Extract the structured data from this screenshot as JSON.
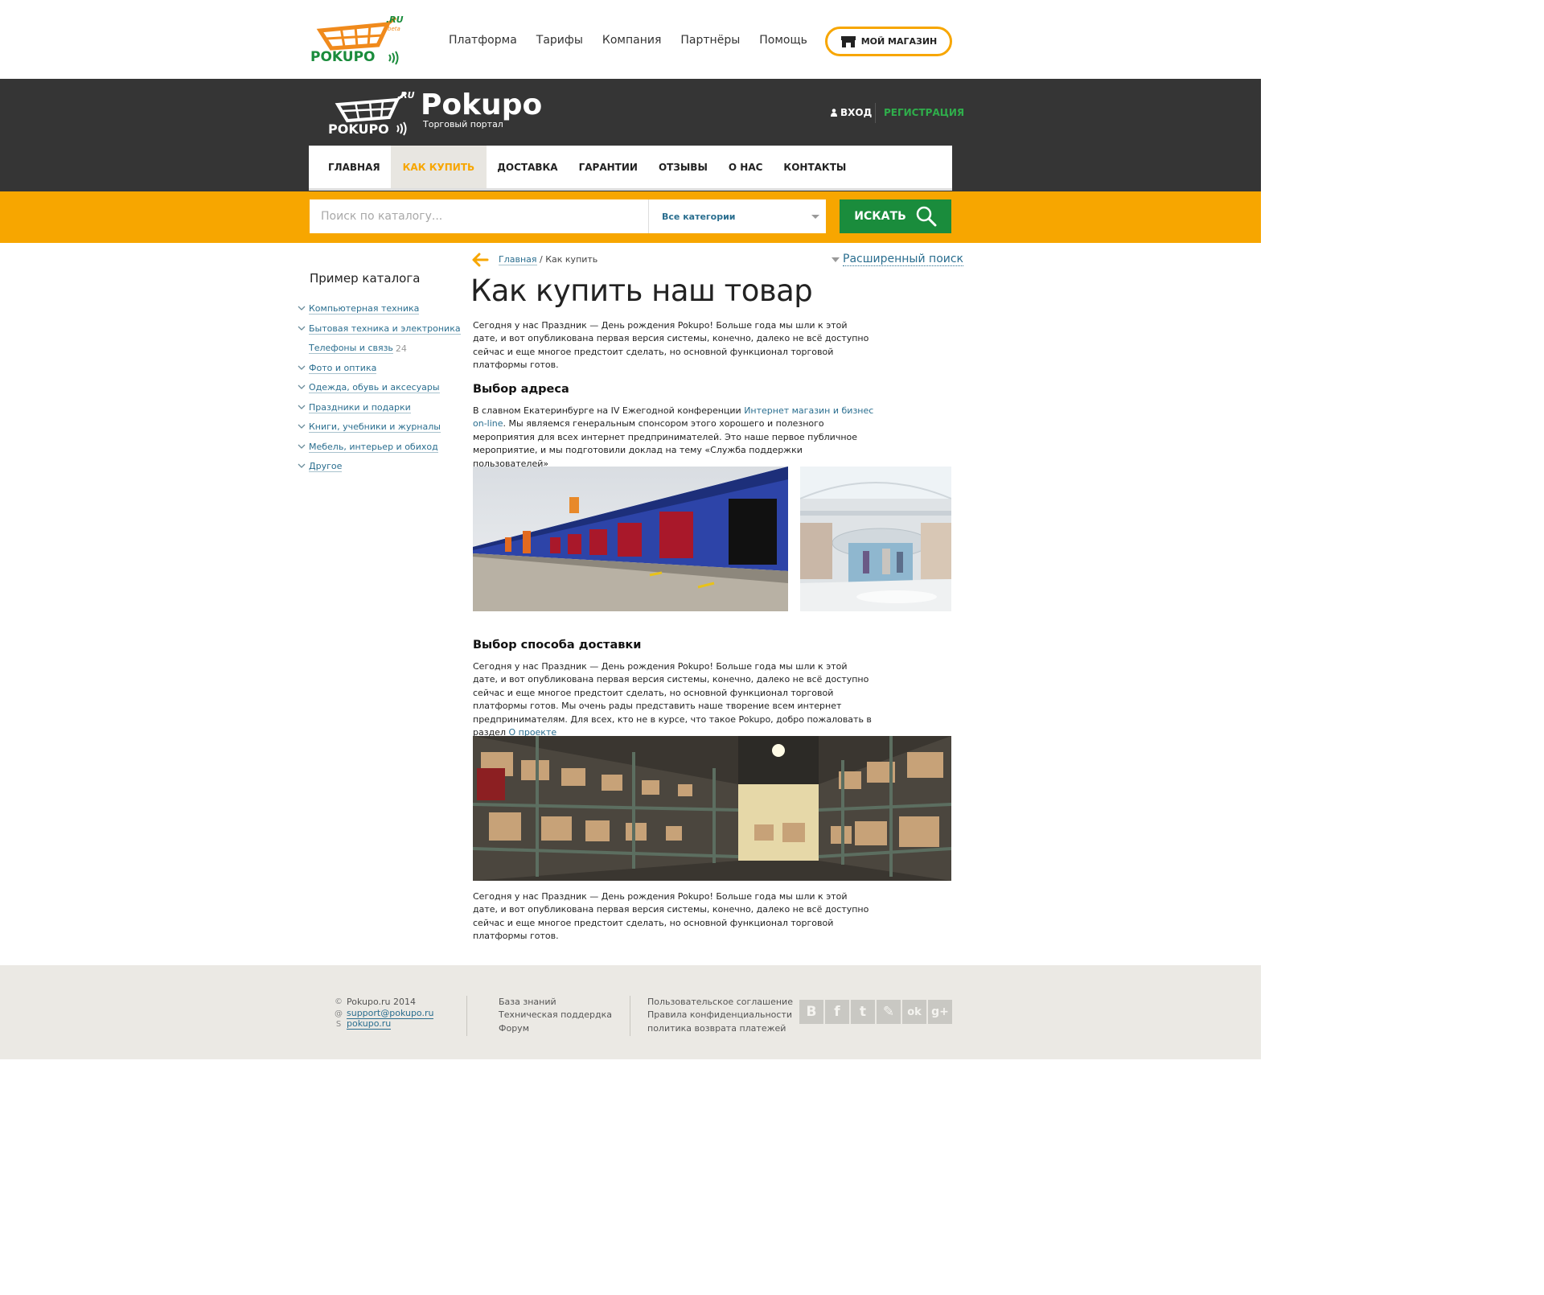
{
  "top": {
    "logo_text": "POKUPO",
    "logo_ru": ".RU",
    "logo_beta": "beta",
    "nav": [
      "Платформа",
      "Тарифы",
      "Компания",
      "Партнёры",
      "Помощь"
    ],
    "my_shop": "МОЙ МАГАЗИН"
  },
  "portal": {
    "name": "Pokupo",
    "subtitle": "Торговый портал",
    "logo_text": "POKUPO",
    "logo_ru": ".RU",
    "login": "ВХОД",
    "register": "РЕГИСТРАЦИЯ"
  },
  "mainnav": [
    "ГЛАВНАЯ",
    "КАК КУПИТЬ",
    "ДОСТАВКА",
    "ГАРАНТИИ",
    "ОТЗЫВЫ",
    "О НАС",
    "КОНТАКТЫ"
  ],
  "mainnav_active": "КАК КУПИТЬ",
  "search": {
    "placeholder": "Поиск по каталогу...",
    "category": "Все категории",
    "button": "ИСКАТЬ"
  },
  "sidebar": {
    "title": "Пример каталога",
    "items": [
      {
        "label": "Компьютерная техника",
        "count": ""
      },
      {
        "label": "Бытовая техника и электроника",
        "count": ""
      },
      {
        "label": "Телефоны и связь",
        "count": "24"
      },
      {
        "label": "Фото и оптика",
        "count": ""
      },
      {
        "label": "Одежда, обувь и аксесуары",
        "count": ""
      },
      {
        "label": "Праздники и подарки",
        "count": ""
      },
      {
        "label": "Книги, учебники и журналы",
        "count": ""
      },
      {
        "label": "Мебель, интерьер и обиход",
        "count": ""
      },
      {
        "label": "Другое",
        "count": ""
      }
    ]
  },
  "breadcrumb": {
    "home": "Главная",
    "sep": " / ",
    "current": "Как купить"
  },
  "advanced_search": "Расширенный поиск",
  "content": {
    "title": "Как купить наш товар",
    "intro": "Сегодня у нас Праздник — День рождения Pokupo! Больше года мы шли к этой дате, и вот опубликована первая версия системы, конечно, далеко не всё доступно сейчас и еще многое предстоит сделать, но основной функционал торговой платформы готов.",
    "h_address": "Выбор адреса",
    "address_before": "В славном Екатеринбурге на IV Ежегодной конференции ",
    "address_link": "Интернет магазин и бизнес on-line",
    "address_after": ". Мы являемся генеральным спонсором этого хорошего и полезного мероприятия для всех интернет предпринимателей. Это наше первое публичное мероприятие, и мы подготовили доклад на тему «Служба поддержки пользователей»",
    "h_delivery": "Выбор способа доставки",
    "delivery_before": "Сегодня у нас Праздник — День рождения Pokupo! Больше года мы шли к этой дате, и вот опубликована первая версия системы, конечно, далеко не всё доступно сейчас и еще многое предстоит сделать, но основной функционал торговой платформы готов. Мы очень рады представить наше творение всем интернет предпринимателям. Для всех, кто не в курсе, что такое Pokupo, добро пожаловать в раздел ",
    "delivery_link": "О проекте",
    "outro": "Сегодня у нас Праздник — День рождения Pokupo! Больше года мы шли к этой дате, и вот опубликована первая версия системы, конечно, далеко не всё доступно сейчас и еще многое предстоит сделать, но основной функционал торговой платформы готов."
  },
  "footer": {
    "copyright": "Pokupo.ru 2014",
    "email": "support@pokupo.ru",
    "skype": "pokupo.ru",
    "col2": [
      "База знаний",
      "Техническая поддердка",
      "Форум"
    ],
    "col3": [
      "Пользовательское соглашение",
      "Правила конфиденциальности",
      "политика возврата платежей"
    ],
    "social": [
      "В",
      "f",
      "t",
      "✎",
      "ok",
      "g+"
    ]
  },
  "colors": {
    "accent": "#f7a600",
    "green": "#1a8c3c",
    "dark": "#353535",
    "link": "#2a6e8f"
  }
}
